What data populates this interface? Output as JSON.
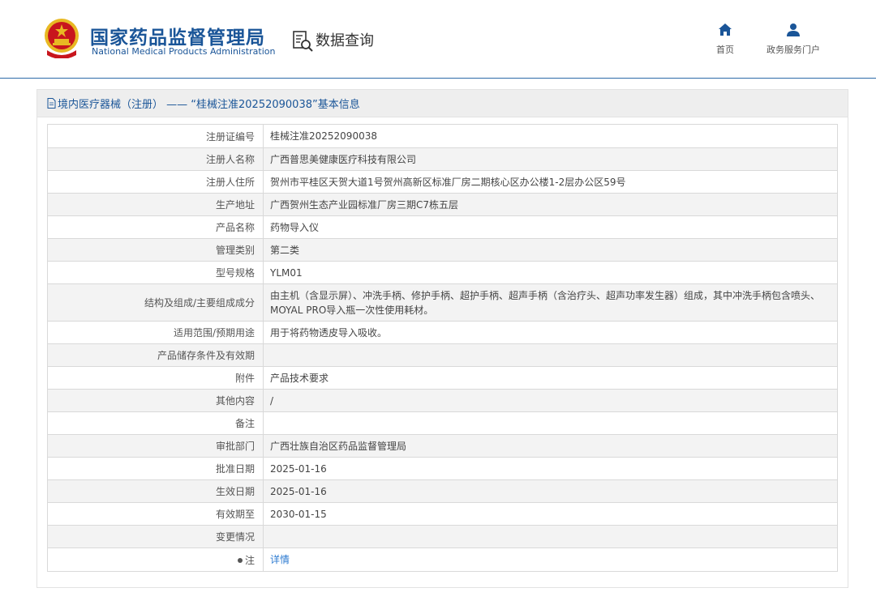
{
  "header": {
    "brand_cn": "国家药品监督管理局",
    "brand_en": "National Medical Products Administration",
    "section_label": "数据查询",
    "nav": [
      {
        "label": "首页",
        "icon": "home-icon"
      },
      {
        "label": "政务服务门户",
        "icon": "user-icon"
      }
    ]
  },
  "panel": {
    "title": "境内医疗器械（注册） —— “桂械注准20252090038”基本信息"
  },
  "rows": [
    {
      "label": "注册证编号",
      "value": "桂械注准20252090038"
    },
    {
      "label": "注册人名称",
      "value": "广西普思美健康医疗科技有限公司"
    },
    {
      "label": "注册人住所",
      "value": "贺州市平桂区天贺大道1号贺州高新区标准厂房二期核心区办公楼1-2层办公区59号"
    },
    {
      "label": "生产地址",
      "value": "广西贺州生态产业园标准厂房三期C7栋五层"
    },
    {
      "label": "产品名称",
      "value": "药物导入仪"
    },
    {
      "label": "管理类别",
      "value": "第二类"
    },
    {
      "label": "型号规格",
      "value": "YLM01"
    },
    {
      "label": "结构及组成/主要组成成分",
      "value": "由主机（含显示屏）、冲洗手柄、修护手柄、超护手柄、超声手柄（含治疗头、超声功率发生器）组成，其中冲洗手柄包含喷头、MOYAL PRO导入瓶一次性使用耗材。"
    },
    {
      "label": "适用范围/预期用途",
      "value": "用于将药物透皮导入吸收。"
    },
    {
      "label": "产品储存条件及有效期",
      "value": ""
    },
    {
      "label": "附件",
      "value": "产品技术要求"
    },
    {
      "label": "其他内容",
      "value": "/"
    },
    {
      "label": "备注",
      "value": ""
    },
    {
      "label": "审批部门",
      "value": "广西壮族自治区药品监督管理局"
    },
    {
      "label": "批准日期",
      "value": "2025-01-16"
    },
    {
      "label": "生效日期",
      "value": "2025-01-16"
    },
    {
      "label": "有效期至",
      "value": "2030-01-15"
    },
    {
      "label": "变更情况",
      "value": ""
    }
  ],
  "note_row": {
    "label": "注",
    "link": "详情"
  },
  "colors": {
    "brand": "#1a5598",
    "link": "#2d7bd1",
    "stripe": "#f3f3f3",
    "emblem_red": "#c8161d",
    "emblem_gold": "#e8b923"
  }
}
